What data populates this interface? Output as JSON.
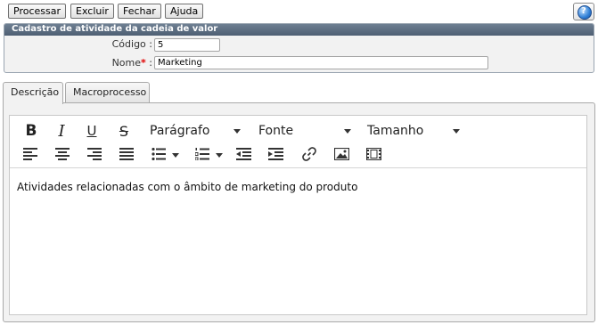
{
  "toolbar": {
    "process_label": "Processar",
    "delete_label": "Excluir",
    "close_label": "Fechar",
    "help_label": "Ajuda"
  },
  "panel": {
    "title": "Cadastro de atividade da cadeia de valor",
    "code_label": "Código :",
    "code_value": "5",
    "name_label": "Nome",
    "name_suffix": " :",
    "required_mark": "*",
    "name_value": "Marketing"
  },
  "tabs": [
    {
      "label": "Descrição",
      "active": true
    },
    {
      "label": "Macroprocesso",
      "active": false
    }
  ],
  "editor": {
    "bold_glyph": "B",
    "italic_glyph": "I",
    "underline_glyph": "U",
    "strike_glyph": "S",
    "format_select": "Parágrafo",
    "font_select": "Fonte",
    "size_select": "Tamanho",
    "content": "Atividades relacionadas com o âmbito de marketing do produto"
  },
  "colors": {
    "panel_header": "#5a6b7e",
    "required": "#e00000"
  }
}
